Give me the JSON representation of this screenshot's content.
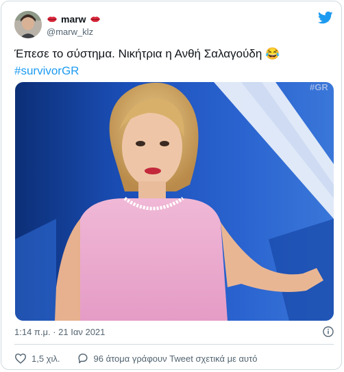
{
  "user": {
    "display_name": "marw",
    "handle": "@marw_klz",
    "name_emoji_left": "lips-emoji",
    "name_emoji_right": "lips-emoji"
  },
  "tweet": {
    "text": "Έπεσε το σύστημα. Νικήτρια η Ανθή Σαλαγούδη 😂",
    "hashtag": "#survivorGR"
  },
  "media": {
    "watermark": "#GR"
  },
  "meta": {
    "timestamp": "1:14 π.μ. · 21 Ιαν 2021",
    "info_icon": "info-icon"
  },
  "actions": {
    "likes_count": "1,5 χιλ.",
    "replies_text": "96 άτομα γράφουν Tweet σχετικά με αυτό"
  },
  "colors": {
    "accent": "#1d9bf0",
    "text_primary": "#0f1419",
    "text_secondary": "#536471",
    "border": "#cfd9de"
  }
}
